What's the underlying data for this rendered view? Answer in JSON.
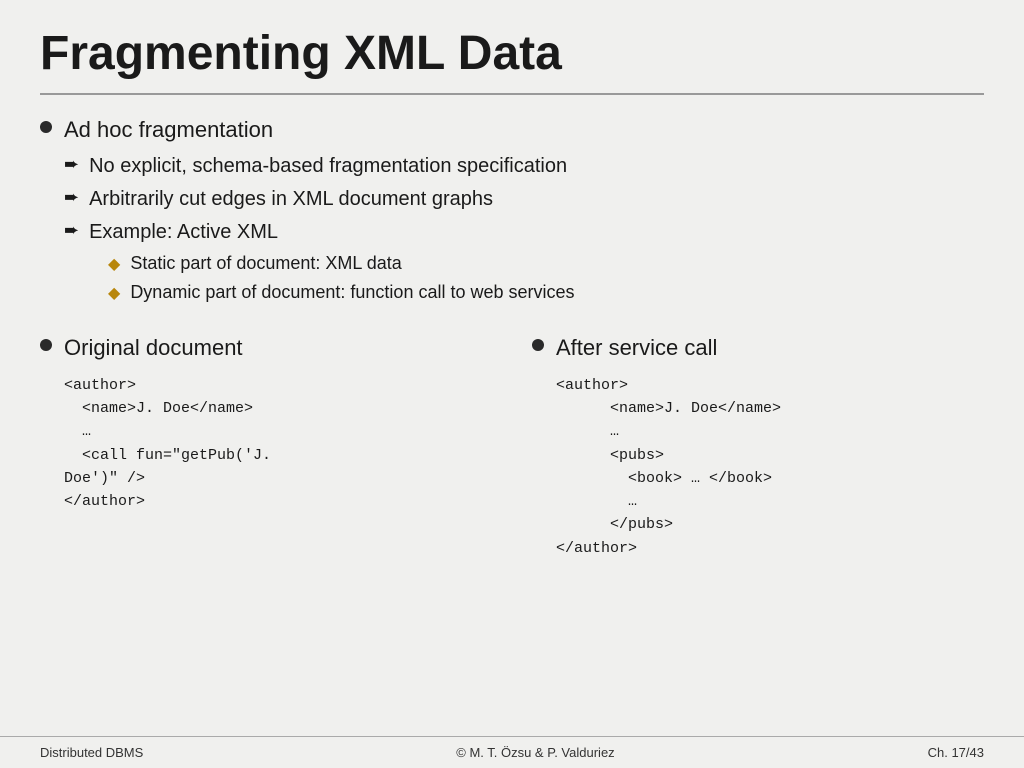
{
  "slide": {
    "title": "Fragmenting XML Data",
    "bullets": [
      {
        "id": "adhoc",
        "text": "Ad hoc fragmentation",
        "sub": [
          {
            "id": "no-explicit",
            "text": "No explicit, schema-based fragmentation specification"
          },
          {
            "id": "arbitrarily",
            "text": "Arbitrarily cut edges in XML document graphs"
          },
          {
            "id": "example",
            "text": "Example: Active XML",
            "sub": [
              {
                "id": "static",
                "text": "Static part of document: XML data"
              },
              {
                "id": "dynamic",
                "text": "Dynamic part of document: function call to web services"
              }
            ]
          }
        ]
      }
    ],
    "two_col": {
      "left": {
        "header": "Original document",
        "code": "<author>\n  <name>J. Doe</name>\n  …\n  <call fun=\"getPub('J.\nDoe')\" />\n</author>"
      },
      "right": {
        "header": "After service call",
        "code": "<author>\n      <name>J. Doe</name>\n      …\n      <pubs>\n        <book> … </book>\n        …\n      </pubs>\n</author>"
      }
    }
  },
  "footer": {
    "left": "Distributed DBMS",
    "center": "© M. T. Özsu & P. Valduriez",
    "right": "Ch. 17/43"
  },
  "icons": {
    "arrow": "➨",
    "diamond": "◆",
    "bullet": "•"
  }
}
